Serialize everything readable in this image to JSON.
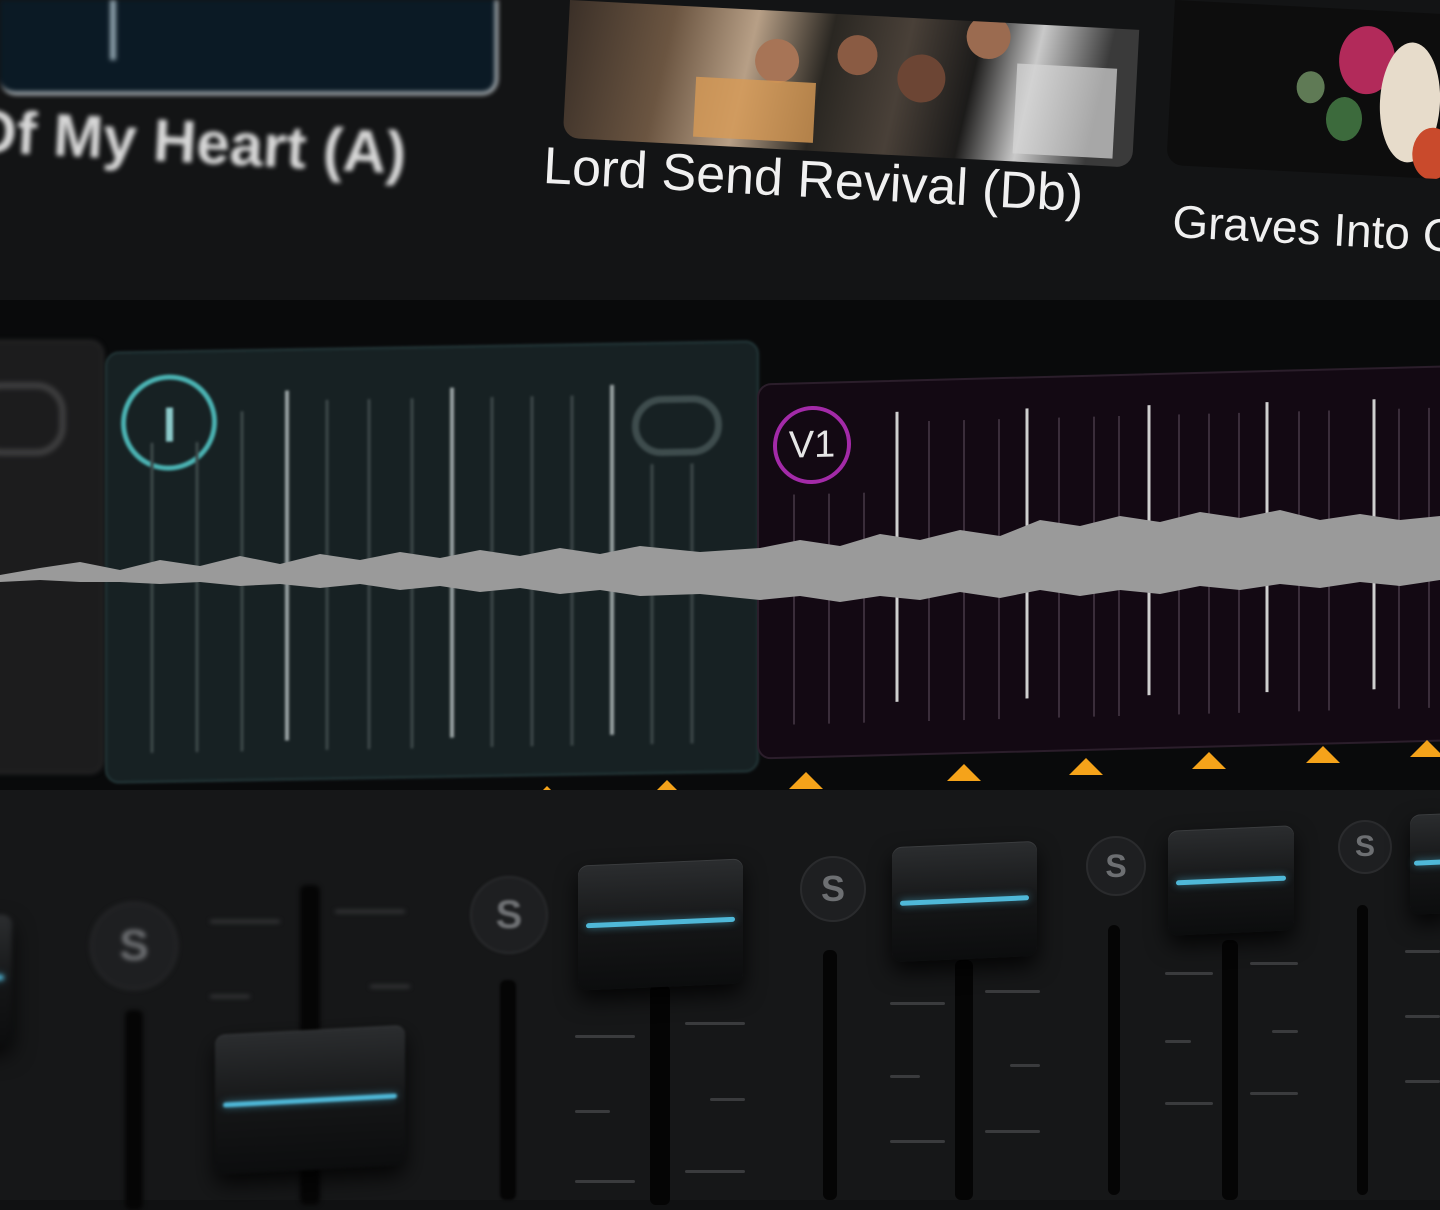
{
  "songs": [
    {
      "title": "Of My Heart (A)"
    },
    {
      "title": "Lord Send Revival (Db)"
    },
    {
      "title": "Graves Into Gar"
    }
  ],
  "timeline": {
    "sections": [
      {
        "marker": "",
        "color": "#4bb3b3"
      },
      {
        "marker": "V1",
        "color": "#a32aa8"
      }
    ]
  },
  "mixer": {
    "solo_label": "S",
    "accent": "#4fb8d8",
    "channels": [
      {
        "solo": "S",
        "level": 0.35
      },
      {
        "solo": "S",
        "level": 0.85
      },
      {
        "solo": "S",
        "level": 0.85
      },
      {
        "solo": "S",
        "level": 0.85
      },
      {
        "solo": "S",
        "level": 0.85
      }
    ]
  },
  "colors": {
    "cue": "#f5a31a",
    "waveform": "#9a9a9a"
  }
}
